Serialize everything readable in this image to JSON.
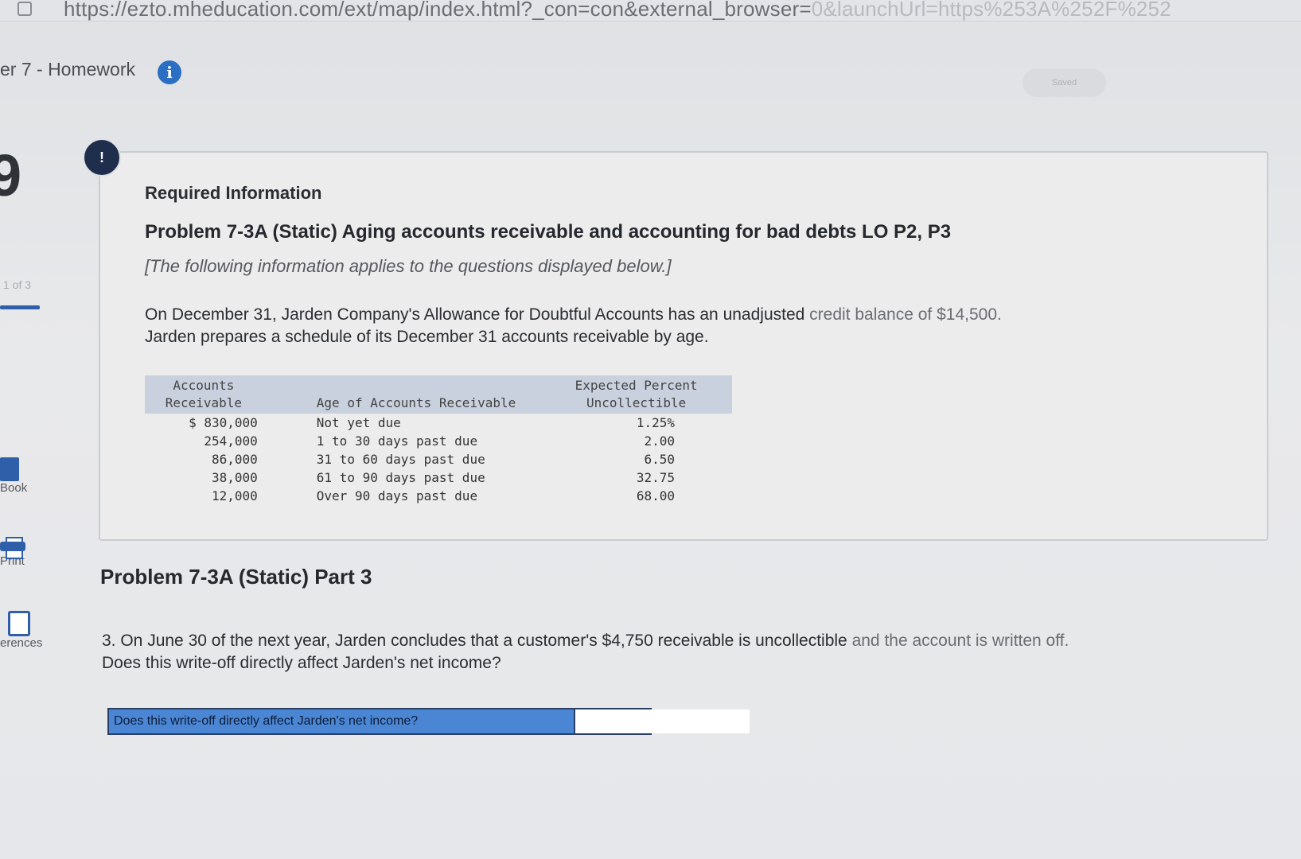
{
  "browser": {
    "url_main": "https://ezto.mheducation.com/ext/map/index.html?_con=con&external_browser=",
    "url_faded": "0&launchUrl=https%253A%252F%252"
  },
  "header": {
    "assignment_title": "er 7 - Homework",
    "info_icon": "i",
    "saved_label": "Saved"
  },
  "sidebar": {
    "question_number": "9",
    "progress_text": "1 of 3",
    "tools": [
      {
        "label": "Book",
        "icon": "ebook-icon"
      },
      {
        "label": "Print",
        "icon": "print-icon"
      },
      {
        "label": "erences",
        "icon": "references-icon"
      }
    ]
  },
  "question_badge": "!",
  "info_box": {
    "heading": "Required Information",
    "problem_title": "Problem 7-3A (Static) Aging accounts receivable and accounting for bad debts LO P2, P3",
    "applies_note": "[The following information applies to the questions displayed below.]",
    "intro_main": "On December 31, Jarden Company's Allowance for Doubtful Accounts has an unadjusted ",
    "intro_faded": "credit balance of $14,500.",
    "intro_line2": "Jarden prepares a schedule of its December 31 accounts receivable by age."
  },
  "aging_table": {
    "headers": {
      "ar_line1": "Accounts",
      "ar_line2": "Receivable",
      "age": "Age of Accounts Receivable",
      "pct_line1": "Expected Percent",
      "pct_line2": "Uncollectible"
    },
    "rows": [
      {
        "ar": "$ 830,000",
        "age": "Not yet due",
        "pct": "1.25%"
      },
      {
        "ar": "254,000",
        "age": "1 to 30 days past due",
        "pct": "2.00"
      },
      {
        "ar": "86,000",
        "age": "31 to 60 days past due",
        "pct": "6.50"
      },
      {
        "ar": "38,000",
        "age": "61 to 90 days past due",
        "pct": "32.75"
      },
      {
        "ar": "12,000",
        "age": "Over 90 days past due",
        "pct": "68.00"
      }
    ]
  },
  "part3": {
    "title": "Problem 7-3A (Static) Part 3",
    "question_main": "3. On June 30 of the next year, Jarden concludes that a customer's $4,750 receivable is uncollectible ",
    "question_faded": "and the account is written off.",
    "question_line2": "Does this write-off directly affect Jarden's net income?",
    "answer_label": "Does this write-off directly affect Jarden's net income?",
    "answer_value": ""
  }
}
